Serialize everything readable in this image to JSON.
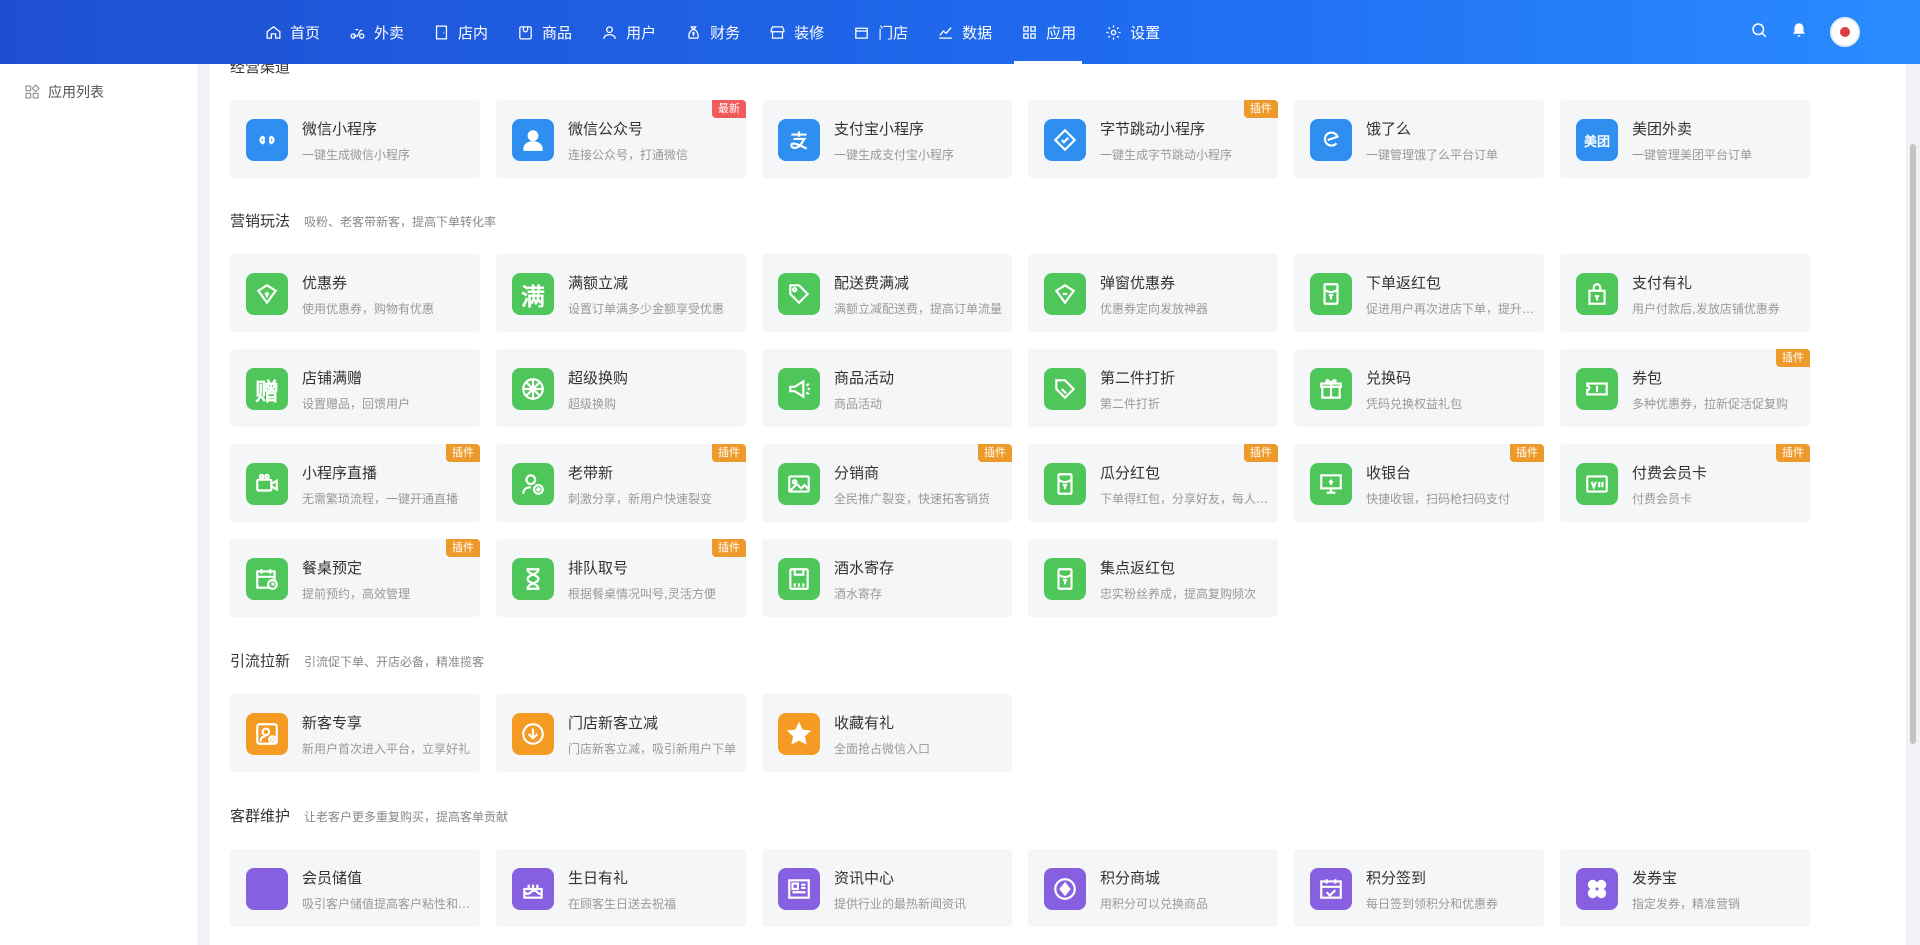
{
  "nav": {
    "items": [
      {
        "label": "首页",
        "icon": "home-icon"
      },
      {
        "label": "外卖",
        "icon": "scooter-icon"
      },
      {
        "label": "店内",
        "icon": "store-door-icon"
      },
      {
        "label": "商品",
        "icon": "goods-icon"
      },
      {
        "label": "用户",
        "icon": "user-icon"
      },
      {
        "label": "财务",
        "icon": "money-bag-icon"
      },
      {
        "label": "装修",
        "icon": "storefront-icon"
      },
      {
        "label": "门店",
        "icon": "shop-icon"
      },
      {
        "label": "数据",
        "icon": "chart-icon"
      },
      {
        "label": "应用",
        "icon": "apps-icon"
      },
      {
        "label": "设置",
        "icon": "gear-icon"
      }
    ],
    "active": "应用"
  },
  "sidebar": {
    "items": [
      {
        "label": "应用列表",
        "icon": "grid-icon"
      }
    ]
  },
  "sections": [
    {
      "title": "经营渠道",
      "subtitle": "",
      "cards": [
        {
          "name": "微信小程序",
          "desc": "一键生成微信小程序",
          "color": "#2f8ff0",
          "icon": "mini-program-icon",
          "badge": ""
        },
        {
          "name": "微信公众号",
          "desc": "连接公众号，打通微信",
          "color": "#2f8ff0",
          "icon": "person-icon",
          "badge": "最新"
        },
        {
          "name": "支付宝小程序",
          "desc": "一键生成支付宝小程序",
          "color": "#2f8ff0",
          "icon": "alipay-icon",
          "badge": ""
        },
        {
          "name": "字节跳动小程序",
          "desc": "一键生成字节跳动小程序",
          "color": "#2f8ff0",
          "icon": "bytedance-icon",
          "badge": "插件"
        },
        {
          "name": "饿了么",
          "desc": "一键管理饿了么平台订单",
          "color": "#2f8ff0",
          "icon": "eleme-icon",
          "badge": ""
        },
        {
          "name": "美团外卖",
          "desc": "一键管理美团平台订单",
          "color": "#2f8ff0",
          "icon": "meituan-icon",
          "badge": ""
        }
      ]
    },
    {
      "title": "营销玩法",
      "subtitle": "吸粉、老客带新客，提高下单转化率",
      "cards": [
        {
          "name": "优惠券",
          "desc": "使用优惠券，购物有优惠",
          "color": "#4fc65a",
          "icon": "coupon-icon",
          "badge": ""
        },
        {
          "name": "满额立减",
          "desc": "设置订单满多少金额享受优惠",
          "color": "#4fc65a",
          "icon": "full-reduce-icon",
          "badge": ""
        },
        {
          "name": "配送费满减",
          "desc": "满额立减配送费，提高订单流量",
          "color": "#4fc65a",
          "icon": "tag-icon",
          "badge": ""
        },
        {
          "name": "弹窗优惠券",
          "desc": "优惠券定向发放神器",
          "color": "#4fc65a",
          "icon": "popup-coupon-icon",
          "badge": ""
        },
        {
          "name": "下单返红包",
          "desc": "促进用户再次进店下单，提升复购率",
          "color": "#4fc65a",
          "icon": "red-packet-icon",
          "badge": ""
        },
        {
          "name": "支付有礼",
          "desc": "用户付款后,发放店铺优惠券",
          "color": "#4fc65a",
          "icon": "gift-bag-icon",
          "badge": ""
        },
        {
          "name": "店铺满赠",
          "desc": "设置赠品，回馈用户",
          "color": "#4fc65a",
          "icon": "gift-text-icon",
          "badge": ""
        },
        {
          "name": "超级换购",
          "desc": "超级换购",
          "color": "#4fc65a",
          "icon": "wheel-icon",
          "badge": ""
        },
        {
          "name": "商品活动",
          "desc": "商品活动",
          "color": "#4fc65a",
          "icon": "megaphone-icon",
          "badge": ""
        },
        {
          "name": "第二件打折",
          "desc": "第二件打折",
          "color": "#4fc65a",
          "icon": "discount-tag-icon",
          "badge": ""
        },
        {
          "name": "兑换码",
          "desc": "凭码兑换权益礼包",
          "color": "#4fc65a",
          "icon": "gift-box-icon",
          "badge": ""
        },
        {
          "name": "券包",
          "desc": "多种优惠券，拉新促活促复购",
          "color": "#4fc65a",
          "icon": "ticket-icon",
          "badge": "插件"
        },
        {
          "name": "小程序直播",
          "desc": "无需繁琐流程，一键开通直播",
          "color": "#4fc65a",
          "icon": "video-icon",
          "badge": "插件"
        },
        {
          "name": "老带新",
          "desc": "刺激分享，新用户快速裂变",
          "color": "#4fc65a",
          "icon": "user-add-icon",
          "badge": "插件"
        },
        {
          "name": "分销商",
          "desc": "全民推广裂变，快速拓客销货",
          "color": "#4fc65a",
          "icon": "image-icon",
          "badge": "插件"
        },
        {
          "name": "瓜分红包",
          "desc": "下单得红包，分享好友，每人都有份",
          "color": "#4fc65a",
          "icon": "red-packet-icon",
          "badge": "插件"
        },
        {
          "name": "收银台",
          "desc": "快捷收银，扫码枪扫码支付",
          "color": "#4fc65a",
          "icon": "cashier-icon",
          "badge": "插件"
        },
        {
          "name": "付费会员卡",
          "desc": "付费会员卡",
          "color": "#4fc65a",
          "icon": "vip-card-icon",
          "badge": "插件"
        },
        {
          "name": "餐桌预定",
          "desc": "提前预约，高效管理",
          "color": "#4fc65a",
          "icon": "calendar-clock-icon",
          "badge": "插件"
        },
        {
          "name": "排队取号",
          "desc": "根据餐桌情况叫号,灵活方便",
          "color": "#4fc65a",
          "icon": "hourglass-icon",
          "badge": "插件"
        },
        {
          "name": "酒水寄存",
          "desc": "酒水寄存",
          "color": "#4fc65a",
          "icon": "storage-icon",
          "badge": ""
        },
        {
          "name": "集点返红包",
          "desc": "忠实粉丝养成，提高复购频次",
          "color": "#4fc65a",
          "icon": "red-packet-icon",
          "badge": ""
        }
      ]
    },
    {
      "title": "引流拉新",
      "subtitle": "引流促下单、开店必备，精准揽客",
      "cards": [
        {
          "name": "新客专享",
          "desc": "新用户首次进入平台，立享好礼",
          "color": "#f59a23",
          "icon": "new-user-icon",
          "badge": ""
        },
        {
          "name": "门店新客立减",
          "desc": "门店新客立减，吸引新用户下单",
          "color": "#f59a23",
          "icon": "down-arrow-icon",
          "badge": ""
        },
        {
          "name": "收藏有礼",
          "desc": "全面抢占微信入口",
          "color": "#f59a23",
          "icon": "star-icon",
          "badge": ""
        }
      ]
    },
    {
      "title": "客群维护",
      "subtitle": "让老客户更多重复购买，提高客单贡献",
      "cards": [
        {
          "name": "会员储值",
          "desc": "吸引客户储值提高客户粘性和复购",
          "color": "#8660e0",
          "icon": "money-bag-icon",
          "badge": ""
        },
        {
          "name": "生日有礼",
          "desc": "在顾客生日送去祝福",
          "color": "#8660e0",
          "icon": "cake-icon",
          "badge": ""
        },
        {
          "name": "资讯中心",
          "desc": "提供行业的最热新闻资讯",
          "color": "#8660e0",
          "icon": "news-icon",
          "badge": ""
        },
        {
          "name": "积分商城",
          "desc": "用积分可以兑换商品",
          "color": "#8660e0",
          "icon": "points-icon",
          "badge": ""
        },
        {
          "name": "积分签到",
          "desc": "每日签到领积分和优惠券",
          "color": "#8660e0",
          "icon": "calendar-check-icon",
          "badge": ""
        },
        {
          "name": "发券宝",
          "desc": "指定发券，精准营销",
          "color": "#8660e0",
          "icon": "four-leaf-icon",
          "badge": ""
        }
      ]
    }
  ]
}
